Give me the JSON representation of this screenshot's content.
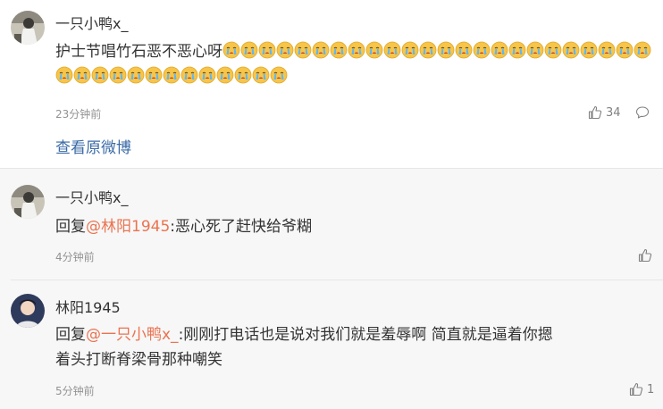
{
  "main_comment": {
    "username": "一只小鸭x_",
    "text": "护士节唱竹石恶不恶心呀",
    "emoji_count": 37,
    "time": "23分钟前",
    "like_count": "34",
    "view_original_label": "查看原微博"
  },
  "replies": [
    {
      "username": "一只小鸭x_",
      "reply_prefix": "回复",
      "mention": "@林阳1945",
      "text": ":恶心死了赶快给爷糊",
      "time": "4分钟前",
      "like_count": ""
    },
    {
      "username": "林阳1945",
      "reply_prefix": "回复",
      "mention": "@一只小鸭x_",
      "text_line1": ":刚刚打电话也是说对我们就是羞辱啊 简直就是逼着你摁",
      "text_line2": "着头打断脊梁骨那种嘲笑",
      "time": "5分钟前",
      "like_count": "1"
    }
  ],
  "icons": {
    "emoji": "crying-face-emoji-icon",
    "like": "thumbs-up-icon",
    "comment": "comment-bubble-icon"
  },
  "colors": {
    "mention": "#eb7350",
    "link": "#3a6aa6",
    "timestamp": "#939393",
    "reply_background": "#f7f7f7"
  }
}
